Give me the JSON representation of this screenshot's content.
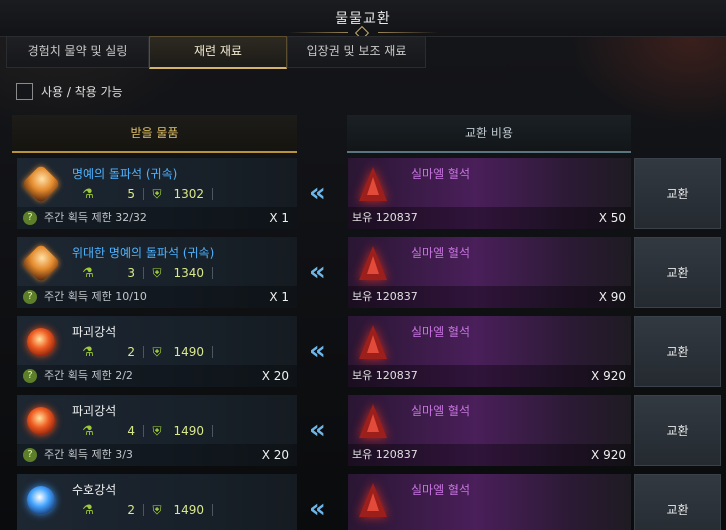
{
  "window": {
    "title": "물물교환"
  },
  "tabs": [
    {
      "label": "경험치 물약 및 실링"
    },
    {
      "label": "재련 재료"
    },
    {
      "label": "입장권 및 보조 재료"
    }
  ],
  "filter": {
    "label": "사용 / 착용 가능",
    "checked": false
  },
  "headers": {
    "receive": "받을 물품",
    "cost": "교환 비용"
  },
  "rows": [
    {
      "item": {
        "name": "명예의 돌파석 (귀속)",
        "icon": "gold-crystal-icon",
        "level": "5",
        "score": "1302",
        "limit": "주간 획득 제한 32/32",
        "qty": "X 1"
      },
      "cost": {
        "name": "실마엘 혈석",
        "icon": "red-crystal-icon",
        "owned": "보유 120837",
        "qty": "X 50"
      },
      "button": "교환"
    },
    {
      "item": {
        "name": "위대한 명예의 돌파석 (귀속)",
        "icon": "gold-crystal-icon",
        "level": "3",
        "score": "1340",
        "limit": "주간 획득 제한 10/10",
        "qty": "X 1"
      },
      "cost": {
        "name": "실마엘 혈석",
        "icon": "red-crystal-icon",
        "owned": "보유 120837",
        "qty": "X 90"
      },
      "button": "교환"
    },
    {
      "item": {
        "name": "파괴강석",
        "icon": "red-stone-icon",
        "level": "2",
        "score": "1490",
        "limit": "주간 획득 제한 2/2",
        "qty": "X 20"
      },
      "cost": {
        "name": "실마엘 혈석",
        "icon": "red-crystal-icon",
        "owned": "보유 120837",
        "qty": "X 920"
      },
      "button": "교환"
    },
    {
      "item": {
        "name": "파괴강석",
        "icon": "red-stone-icon",
        "level": "4",
        "score": "1490",
        "limit": "주간 획득 제한 3/3",
        "qty": "X 20"
      },
      "cost": {
        "name": "실마엘 혈석",
        "icon": "red-crystal-icon",
        "owned": "보유 120837",
        "qty": "X 920"
      },
      "button": "교환"
    },
    {
      "item": {
        "name": "수호강석",
        "icon": "blue-stone-icon",
        "level": "2",
        "score": "1490",
        "limit": "",
        "qty": ""
      },
      "cost": {
        "name": "실마엘 혈석",
        "icon": "red-crystal-icon",
        "owned": "",
        "qty": ""
      },
      "button": "교환"
    }
  ],
  "colors": {
    "accent_gold": "#d4b46a",
    "item_blue": "#4fb3ff",
    "cost_purple": "#c874e0",
    "arrow": "#6fb6e8"
  }
}
